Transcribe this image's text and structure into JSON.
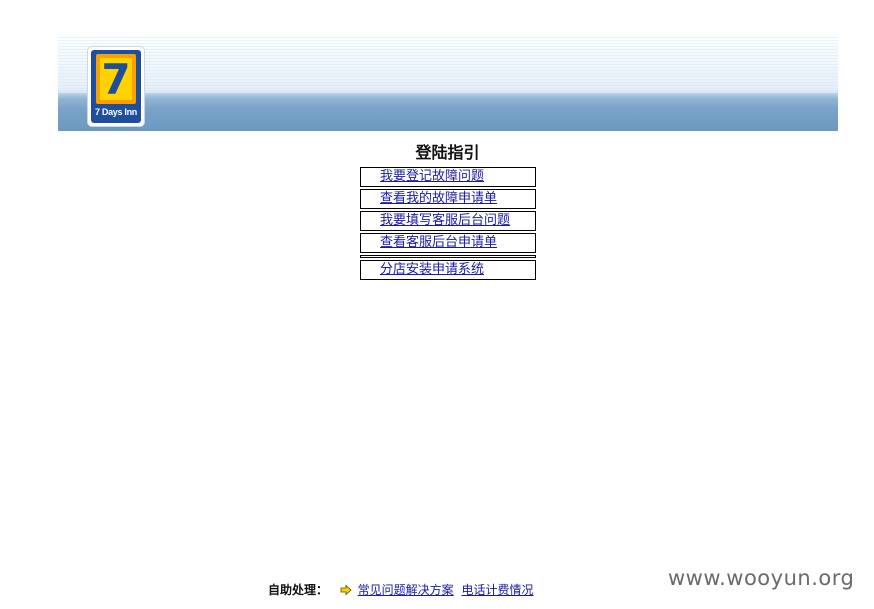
{
  "header": {
    "logo_text": "7 Days Inn",
    "logo_number": "7",
    "brand_colors": {
      "navy": "#1f4f9c",
      "orange": "#f5a100",
      "yellow": "#ffd200"
    }
  },
  "main": {
    "title": "登陆指引",
    "menu_items": [
      {
        "label": "我要登记故障问题"
      },
      {
        "label": "查看我的故障申请单"
      },
      {
        "label": "我要填写客服后台问题"
      },
      {
        "label": "查看客服后台申请单"
      },
      {
        "label": "分店安装申请系统"
      }
    ]
  },
  "footer": {
    "label": "自助处理：",
    "arrow_icon": "arrow-right-icon",
    "links": [
      {
        "label": "常见问题解决方案"
      },
      {
        "label": "电话计费情况"
      }
    ]
  },
  "watermark": "www.wooyun.org",
  "colors": {
    "link": "#1a1aa6",
    "banner_band": "#7aa3c8"
  }
}
